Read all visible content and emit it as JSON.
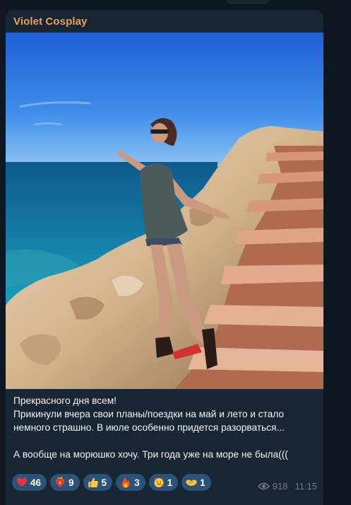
{
  "post": {
    "channel_name": "Violet Cosplay",
    "image_alt": "photo",
    "text_lines": [
      "Прекрасного дня всем!",
      "Прикинули вчера свои планы/поездки на май и лето и стало",
      "немного страшно. В июле особенно придется разорваться...",
      "",
      "А вообще на морюшко хочу. Три года уже на море не была((("
    ],
    "reactions": [
      {
        "emoji": "red-heart-icon",
        "count": "46"
      },
      {
        "emoji": "heart-on-fire-icon",
        "count": "9"
      },
      {
        "emoji": "thumbs-up-icon",
        "count": "5"
      },
      {
        "emoji": "fire-icon",
        "count": "3"
      },
      {
        "emoji": "smiling-face-with-hearts-icon",
        "count": "1"
      },
      {
        "emoji": "handshake-icon",
        "count": "1"
      }
    ],
    "views": "918",
    "time": "11:15"
  },
  "colors": {
    "background": "#0e1621",
    "bubble": "#182533",
    "channel_name": "#e8a35b",
    "reaction_chip": "#2b5278",
    "meta": "#6d7f8f"
  }
}
